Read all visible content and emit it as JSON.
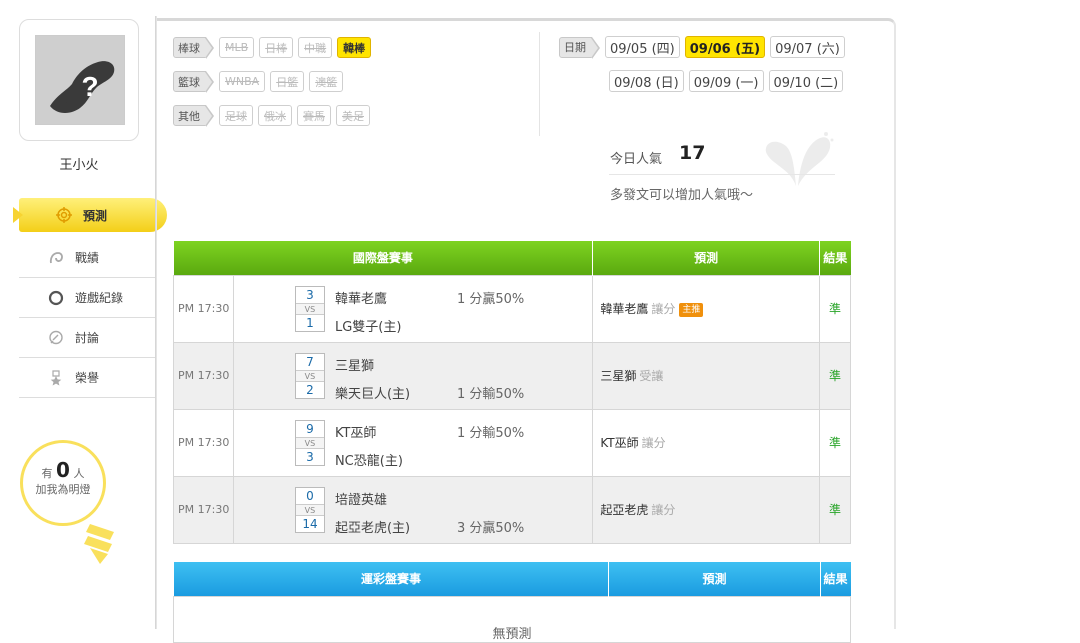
{
  "user": {
    "name": "王小火",
    "avatar_icon": "unknown-avatar-icon"
  },
  "nav": [
    {
      "label": "預測",
      "icon": "target-icon",
      "active": true
    },
    {
      "label": "戰績",
      "icon": "record-icon",
      "active": false
    },
    {
      "label": "遊戲紀錄",
      "icon": "circle-icon",
      "active": false
    },
    {
      "label": "討論",
      "icon": "discussion-icon",
      "active": false
    },
    {
      "label": "榮譽",
      "icon": "medal-icon",
      "active": false
    }
  ],
  "fans": {
    "prefix": "有",
    "count": "0",
    "suffix": "人",
    "line2": "加我為明燈"
  },
  "filters": {
    "baseball": {
      "tag": "棒球",
      "items": [
        "MLB",
        "日棒",
        "中職",
        "韓棒"
      ],
      "active": "韓棒"
    },
    "basketball": {
      "tag": "籃球",
      "items": [
        "WNBA",
        "日籃",
        "澳籃"
      ],
      "active": ""
    },
    "other": {
      "tag": "其他",
      "items": [
        "足球",
        "俄冰",
        "賽馬",
        "美足"
      ],
      "active": ""
    }
  },
  "dates": {
    "tag": "日期",
    "row1": [
      "09/05 (四)",
      "09/06 (五)",
      "09/07 (六)"
    ],
    "row2": [
      "09/08 (日)",
      "09/09 (一)",
      "09/10 (二)"
    ],
    "active": "09/06 (五)"
  },
  "popularity": {
    "label": "今日人氣",
    "value": "17",
    "tip": "多發文可以增加人氣哦～"
  },
  "intl_table": {
    "headers": [
      "國際盤賽事",
      "預測",
      "結果"
    ],
    "rows": [
      {
        "time": "PM 17:30",
        "score_top": "3",
        "vs": "VS",
        "score_bot": "1",
        "team_top": "韓華老鷹",
        "team_bot": "LG雙子(主)",
        "handicap": "1 分贏50%",
        "handicap_pos": "top",
        "pred_team": "韓華老鷹",
        "pred_type": "讓分",
        "badge": "主推",
        "result": "準"
      },
      {
        "time": "PM 17:30",
        "score_top": "7",
        "vs": "VS",
        "score_bot": "2",
        "team_top": "三星獅",
        "team_bot": "樂天巨人(主)",
        "handicap": "1 分輸50%",
        "handicap_pos": "bot",
        "pred_team": "三星獅",
        "pred_type": "受讓",
        "badge": "",
        "result": "準"
      },
      {
        "time": "PM 17:30",
        "score_top": "9",
        "vs": "VS",
        "score_bot": "3",
        "team_top": "KT巫師",
        "team_bot": "NC恐龍(主)",
        "handicap": "1 分輸50%",
        "handicap_pos": "top",
        "pred_team": "KT巫師",
        "pred_type": "讓分",
        "badge": "",
        "result": "準"
      },
      {
        "time": "PM 17:30",
        "score_top": "0",
        "vs": "VS",
        "score_bot": "14",
        "team_top": "培證英雄",
        "team_bot": "起亞老虎(主)",
        "handicap": "3 分贏50%",
        "handicap_pos": "bot",
        "pred_team": "起亞老虎",
        "pred_type": "讓分",
        "badge": "",
        "result": "準"
      }
    ]
  },
  "lottery_table": {
    "headers": [
      "運彩盤賽事",
      "預測",
      "結果"
    ],
    "empty_text": "無預測"
  },
  "colors": {
    "accent_yellow": "#ffe400",
    "header_green": "#6cbf1a",
    "header_blue": "#27abe8",
    "result_green": "#2aa52a"
  }
}
